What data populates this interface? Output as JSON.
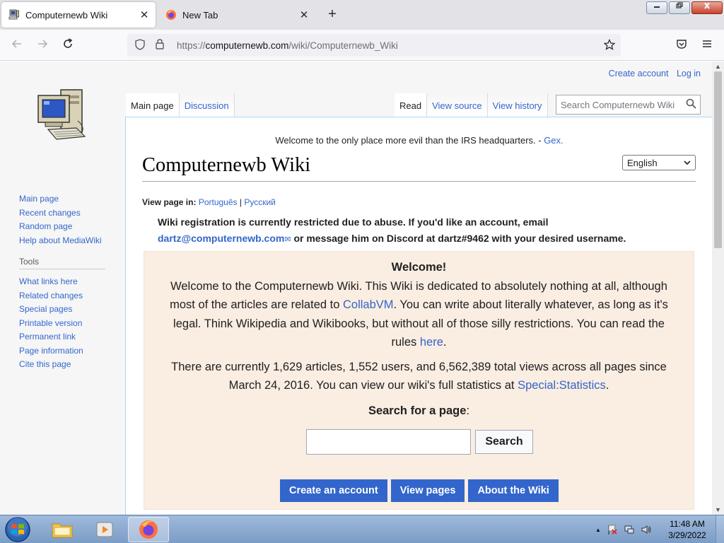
{
  "browser": {
    "tabs": [
      {
        "title": "Computernewb Wiki",
        "active": true
      },
      {
        "title": "New Tab",
        "active": false
      }
    ],
    "new_tab_symbol": "+",
    "close_symbol": "✕",
    "url": {
      "protocol": "https://",
      "host": "computernewb.com",
      "path": "/wiki/Computernewb_Wiki"
    },
    "icons": [
      "back-arrow-icon",
      "forward-arrow-icon",
      "reload-icon",
      "shield-icon",
      "lock-icon",
      "star-icon",
      "pocket-icon",
      "menu-icon"
    ]
  },
  "personal_tools": {
    "create_account": "Create account",
    "log_in": "Log in"
  },
  "sidebar": {
    "nav": [
      "Main page",
      "Recent changes",
      "Random page",
      "Help about MediaWiki"
    ],
    "tools_heading": "Tools",
    "tools": [
      "What links here",
      "Related changes",
      "Special pages",
      "Printable version",
      "Permanent link",
      "Page information",
      "Cite this page"
    ]
  },
  "views": {
    "left": [
      "Main page",
      "Discussion"
    ],
    "right": [
      "Read",
      "View source",
      "View history"
    ]
  },
  "search": {
    "placeholder": "Search Computernewb Wiki"
  },
  "content": {
    "sitenotice_text": "Welcome to the only place more evil than the IRS headquarters. - ",
    "sitenotice_link": "Gex.",
    "language": "English",
    "title": "Computernewb Wiki",
    "view_in_label": "View page in:",
    "view_in_links": [
      "Português",
      "Русский"
    ],
    "view_in_sep": "|",
    "registration": {
      "line1": "Wiki registration is currently restricted due to abuse. If you'd like an account, email",
      "email": "dartz@computernewb.com",
      "line2": " or message him on Discord at dartz#9462 with your desired username."
    },
    "welcome": {
      "heading": "Welcome!",
      "p1_a": "Welcome to the Computernewb Wiki. This Wiki is dedicated to absolutely nothing at all, although most of the articles are related to ",
      "p1_link1": "CollabVM",
      "p1_b": ". You can write about literally whatever, as long as it's legal. Think Wikipedia and Wikibooks, but without all of those silly restrictions. You can read the rules ",
      "p1_link2": "here",
      "p1_c": ".",
      "p2_a": "There are currently 1,629 articles, 1,552 users, and 6,562,389 total views across all pages since March 24, 2016. You can view our wiki's full statistics at ",
      "p2_link": "Special:Statistics",
      "p2_b": ".",
      "search_label": "Search for a page",
      "search_colon": ":",
      "search_button": "Search",
      "buttons": [
        "Create an account",
        "View pages",
        "About the Wiki"
      ]
    }
  },
  "taskbar": {
    "clock_time": "11:48 AM",
    "clock_date": "3/29/2022",
    "tray_arrow": "▲"
  }
}
